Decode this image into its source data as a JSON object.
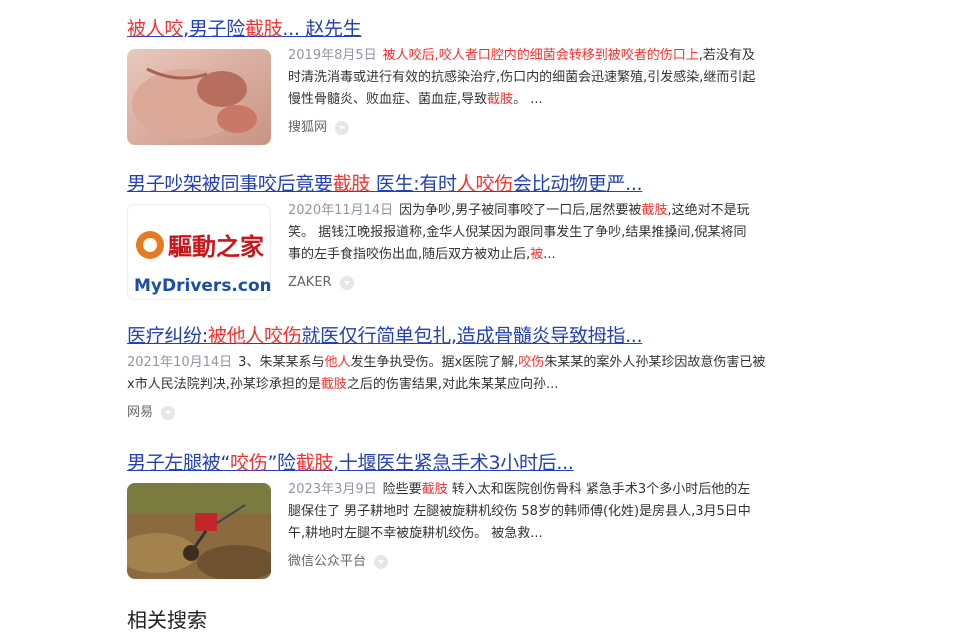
{
  "results": [
    {
      "title_parts": [
        {
          "t": "被人咬",
          "hl": true
        },
        {
          "t": ",男子险",
          "hl": false
        },
        {
          "t": "截肢",
          "hl": true
        },
        {
          "t": "...  赵先生",
          "hl": false
        }
      ],
      "date": "2019年8月5日",
      "snippet_parts": [
        {
          "t": "被人咬后,咬人者口腔内的细菌会转移到被咬者的伤口上",
          "hl": true
        },
        {
          "t": ",若没有及时清洗消毒或进行有效的抗感染治疗,伤口内的细菌会迅速繁殖,引发感染,继而引起慢性骨髓炎、败血症、菌血症,导致",
          "hl": false
        },
        {
          "t": "截肢",
          "hl": true
        },
        {
          "t": "。 ...",
          "hl": false
        }
      ],
      "source": "搜狐网"
    },
    {
      "title_parts": [
        {
          "t": "男子吵架被同事咬后竟要",
          "hl": false
        },
        {
          "t": "截肢",
          "hl": true
        },
        {
          "t": " 医生:有时",
          "hl": false
        },
        {
          "t": "人咬伤",
          "hl": true
        },
        {
          "t": "会比动物更严...",
          "hl": false
        }
      ],
      "date": "2020年11月14日",
      "snippet_parts": [
        {
          "t": "因为争吵,男子被同事咬了一口后,居然要被",
          "hl": false
        },
        {
          "t": "截肢",
          "hl": true
        },
        {
          "t": ",这绝对不是玩笑。 据钱江晚报报道称,金华人倪某因为跟同事发生了争吵,结果推搡间,倪某将同事的左手食指咬伤出血,随后双方被劝止后,",
          "hl": false
        },
        {
          "t": "被",
          "hl": true
        },
        {
          "t": "...",
          "hl": false
        }
      ],
      "source": "ZAKER",
      "logo_text_cn": "驅動之家",
      "logo_text_en": "MyDrivers.com"
    },
    {
      "title_parts": [
        {
          "t": "医疗纠纷:",
          "hl": false
        },
        {
          "t": "被他人咬伤",
          "hl": true
        },
        {
          "t": "就医仅行简单包扎,造成骨髓炎导致拇指...",
          "hl": false
        }
      ],
      "date": "2021年10月14日",
      "snippet_parts": [
        {
          "t": "3、朱某某系与",
          "hl": false
        },
        {
          "t": "他人",
          "hl": true
        },
        {
          "t": "发生争执受伤。据x医院了解,",
          "hl": false
        },
        {
          "t": "咬伤",
          "hl": true
        },
        {
          "t": "朱某某的案外人孙某珍因故意伤害已被x市人民法院判决,孙某珍承担的是",
          "hl": false
        },
        {
          "t": "截肢",
          "hl": true
        },
        {
          "t": "之后的伤害结果,对此朱某某应向孙...",
          "hl": false
        }
      ],
      "source": "网易"
    },
    {
      "title_parts": [
        {
          "t": "男子左腿被“",
          "hl": false
        },
        {
          "t": "咬伤",
          "hl": true
        },
        {
          "t": "”险",
          "hl": false
        },
        {
          "t": "截肢",
          "hl": true
        },
        {
          "t": ",十堰医生紧急手术3小时后...",
          "hl": false
        }
      ],
      "date": "2023年3月9日",
      "snippet_parts": [
        {
          "t": "险些要",
          "hl": false
        },
        {
          "t": "截肢",
          "hl": true
        },
        {
          "t": " 转入太和医院创伤骨科 紧急手术3个多小时后他的左腿保住了 男子耕地时 左腿被旋耕机绞伤 58岁的韩师傅(化姓)是房县人,3月5日中午,耕地时左腿不幸被旋耕机绞伤。 被急救...",
          "hl": false
        }
      ],
      "source": "微信公众平台"
    }
  ],
  "related_heading": "相关搜索"
}
